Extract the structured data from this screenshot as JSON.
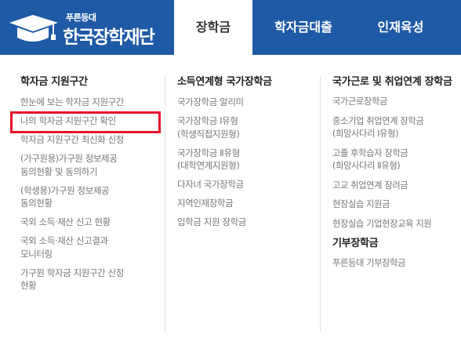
{
  "header": {
    "logo": {
      "sub": "푸른등대",
      "main": "한국장학재단"
    },
    "tabs": [
      {
        "label": "장학금",
        "active": true
      },
      {
        "label": "학자금대출",
        "active": false
      },
      {
        "label": "인재육성",
        "active": false
      }
    ]
  },
  "menu": {
    "columns": [
      {
        "title": "학자금 지원구간",
        "items": [
          {
            "lines": [
              "한눈에 보는 학자금 지원구간"
            ]
          },
          {
            "lines": [
              "나의 학자금 지원구간 확인"
            ]
          },
          {
            "lines": [
              "학자금 지원구간 최신화 신청"
            ]
          },
          {
            "lines": [
              "(가구원용)가구원 정보제공",
              "동의현황 및 동의하기"
            ]
          },
          {
            "lines": [
              "(학생용)가구원 정보제공",
              "동의현황"
            ]
          },
          {
            "lines": [
              "국외 소득·재산 신고 현황"
            ]
          },
          {
            "lines": [
              "국외 소득·재산 신고결과",
              "모니터링"
            ]
          },
          {
            "lines": [
              "가구원 학자금 지원구간 산정",
              "현황"
            ]
          }
        ]
      },
      {
        "title": "소득연계형 국가장학금",
        "items": [
          {
            "lines": [
              "국가장학금 알리미"
            ]
          },
          {
            "lines": [
              "국가장학금 Ⅰ유형",
              "(학생직접지원형)"
            ]
          },
          {
            "lines": [
              "국가장학금 Ⅱ유형",
              "(대학연계지원형)"
            ]
          },
          {
            "lines": [
              "다자녀 국가장학금"
            ]
          },
          {
            "lines": [
              "지역인재장학금"
            ]
          },
          {
            "lines": [
              "입학금 지원 장학금"
            ]
          }
        ]
      },
      {
        "title": "국가근로 및 취업연계 장학금",
        "items": [
          {
            "lines": [
              "국가근로장학금"
            ]
          },
          {
            "lines": [
              "중소기업 취업연계 장학금",
              "(희망사다리 Ⅰ유형)"
            ]
          },
          {
            "lines": [
              "고졸 후학습자 장학금",
              "(희망사다리 Ⅱ유형)"
            ]
          },
          {
            "lines": [
              "고교 취업연계 장려금"
            ]
          },
          {
            "lines": [
              "현장실습 지원금"
            ]
          },
          {
            "lines": [
              "현장실습 기업현장교육 지원"
            ]
          }
        ],
        "title2": "기부장학금",
        "items2": [
          {
            "lines": [
              "푸른등대 기부장학금"
            ]
          }
        ]
      }
    ]
  },
  "colors": {
    "header_blue": "#1f5aa6",
    "highlight_red": "#e3142a",
    "item_gray": "#777777",
    "title_dark": "#222222"
  }
}
